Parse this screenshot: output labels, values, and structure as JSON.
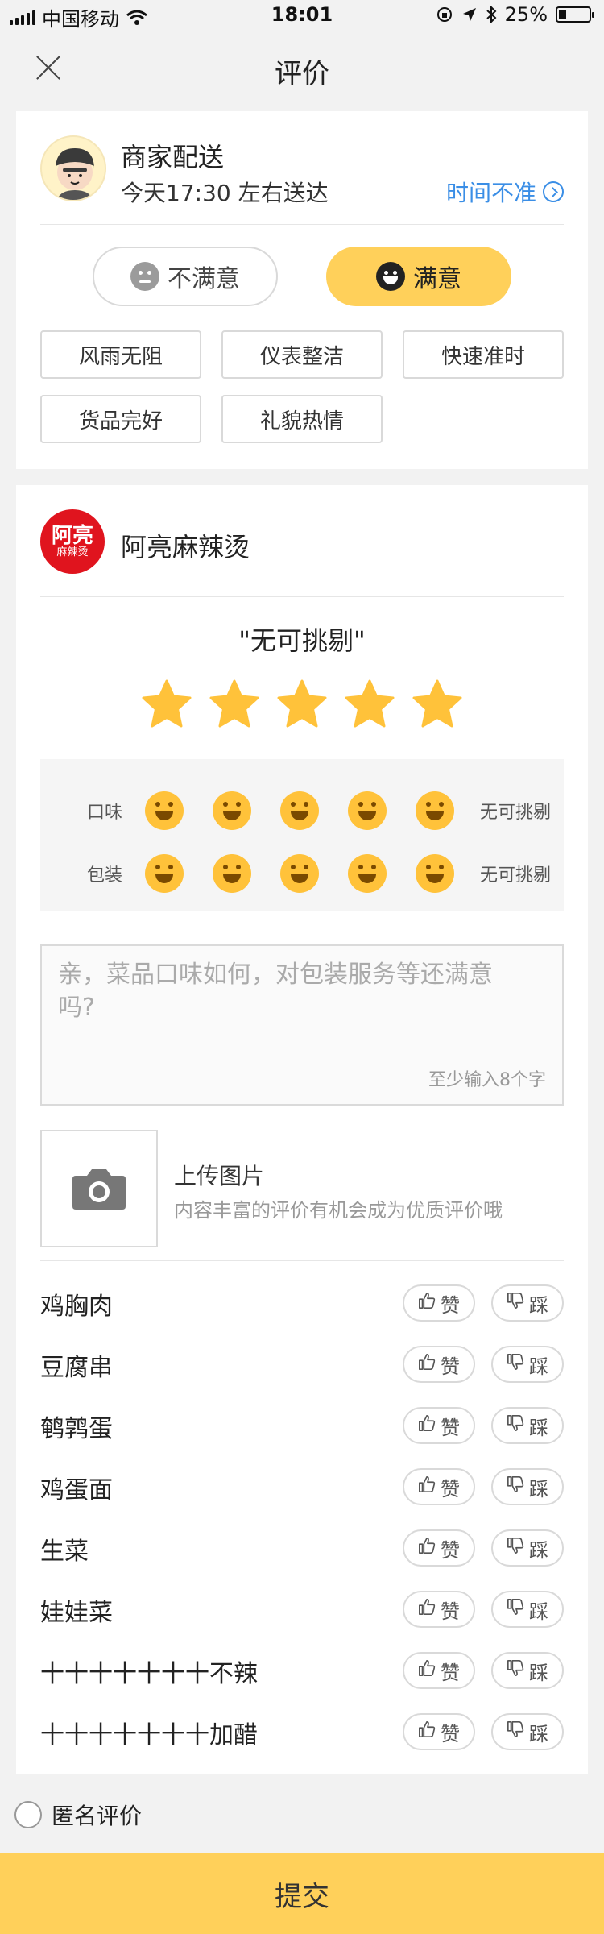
{
  "status_bar": {
    "carrier": "中国移动",
    "time": "18:01",
    "battery": "25%",
    "battery_level": 0.25
  },
  "nav": {
    "title": "评价"
  },
  "delivery": {
    "title": "商家配送",
    "time": "今天17:30 左右送达",
    "time_inaccurate": "时间不准",
    "unsatisfied": "不满意",
    "satisfied": "满意",
    "tags": [
      "风雨无阻",
      "仪表整洁",
      "快速准时",
      "货品完好",
      "礼貌热情"
    ]
  },
  "shop": {
    "logo_big": "阿亮",
    "logo_small": "麻辣烫",
    "name": "阿亮麻辣烫",
    "rating_text": "\"无可挑剔\"",
    "stars": 5,
    "sub_ratings": [
      {
        "label": "口味",
        "result": "无可挑剔"
      },
      {
        "label": "包装",
        "result": "无可挑剔"
      }
    ],
    "comment_placeholder": "亲，菜品口味如何，对包装服务等还满意吗?",
    "comment_hint": "至少输入8个字",
    "upload_title": "上传图片",
    "upload_sub": "内容丰富的评价有机会成为优质评价哦",
    "like_label": "赞",
    "dislike_label": "踩",
    "dishes": [
      "鸡胸肉",
      "豆腐串",
      "鹌鹑蛋",
      "鸡蛋面",
      "生菜",
      "娃娃菜",
      "十十十十十十十不辣",
      "十十十十十十十加醋"
    ]
  },
  "anonymous_label": "匿名评价",
  "submit_label": "提交",
  "colors": {
    "accent": "#ffd05a",
    "link": "#3a8ee6",
    "star": "#ffc23a",
    "logo_red": "#e0141e"
  }
}
